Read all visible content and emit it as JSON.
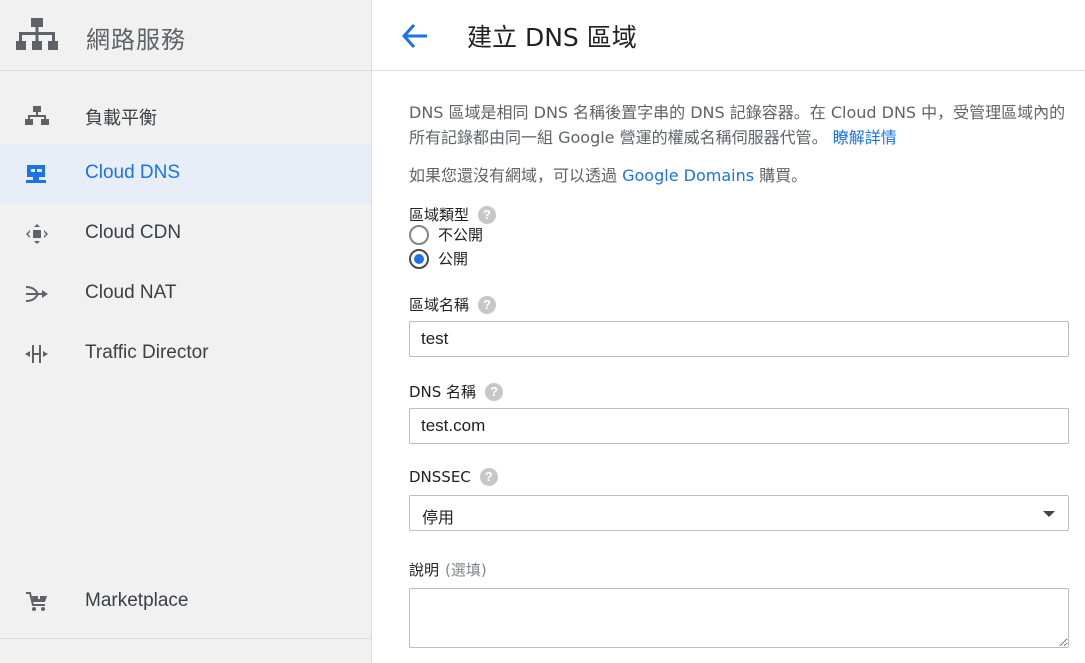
{
  "sidebar": {
    "product_title": "網路服務",
    "product_icon": "network-hierarchy-icon",
    "items": [
      {
        "label": "負載平衡",
        "icon": "load-balancing-icon"
      },
      {
        "label": "Cloud DNS",
        "icon": "cloud-dns-icon",
        "active": true
      },
      {
        "label": "Cloud CDN",
        "icon": "cloud-cdn-icon"
      },
      {
        "label": "Cloud NAT",
        "icon": "cloud-nat-icon"
      },
      {
        "label": "Traffic Director",
        "icon": "traffic-director-icon"
      }
    ],
    "marketplace": {
      "label": "Marketplace",
      "icon": "cart-icon"
    }
  },
  "header": {
    "title": "建立 DNS 區域",
    "back_icon": "arrow-back-icon"
  },
  "description": {
    "text": "DNS 區域是相同 DNS 名稱後置字串的 DNS 記錄容器。在 Cloud DNS 中，受管理區域內的所有記錄都由同一組 Google 營運的權威名稱伺服器代管。",
    "learn_more": "瞭解詳情",
    "domains_prefix": "如果您還沒有網域，可以透過",
    "domains_link": "Google Domains",
    "domains_suffix": "購買。"
  },
  "form": {
    "zone_type": {
      "label": "區域類型",
      "options": [
        {
          "label": "不公開",
          "checked": false
        },
        {
          "label": "公開",
          "checked": true
        }
      ]
    },
    "zone_name": {
      "label": "區域名稱",
      "value": "test"
    },
    "dns_name": {
      "label": "DNS 名稱",
      "value": "test.com"
    },
    "dnssec": {
      "label": "DNSSEC",
      "value": "停用"
    },
    "description": {
      "label": "說明",
      "optional": "(選填)",
      "value": ""
    }
  },
  "colors": {
    "accent": "#1a73e8",
    "sidebar_bg": "#f1f1f1",
    "active_bg": "#e8eef7"
  }
}
